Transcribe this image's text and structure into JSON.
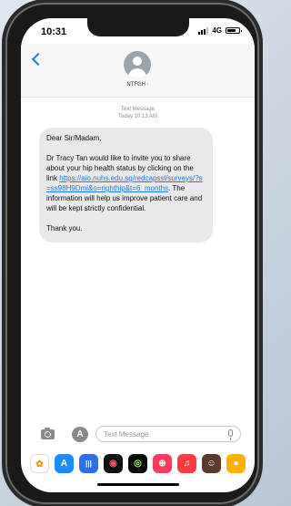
{
  "status_bar": {
    "time": "10:31",
    "network": "4G",
    "signal_level": 0.75,
    "battery_level": 0.75
  },
  "header": {
    "contact_name": "NTFGH"
  },
  "conversation": {
    "message_type": "Text Message",
    "timestamp": "Today 10:13 AM",
    "message": {
      "greeting": "Dear Sir/Madam,",
      "body_before_link": "Dr Tracy Tan would like to invite you to share about your hip health status by clicking on the link",
      "link": "https://aio.nuhs.edu.sg/redcapssl/surveys/?s=ss98H9Dmi&o=righthip&t=6_months",
      "body_after_link": ". The information will help us improve patient care and will be kept strictly confidential.",
      "closing": "Thank you."
    }
  },
  "input_bar": {
    "placeholder": "Text Message"
  },
  "dock_apps": [
    {
      "icon": "photos-icon",
      "color": "#ffffff"
    },
    {
      "icon": "app-store-icon",
      "color": "#1a8cff"
    },
    {
      "icon": "audio-message-icon",
      "color": "#2f6fe4"
    },
    {
      "icon": "digital-touch-icon",
      "color": "#111111"
    },
    {
      "icon": "activity-icon",
      "color": "#0b0b0b"
    },
    {
      "icon": "search-images-icon",
      "color": "#ff3b5c"
    },
    {
      "icon": "music-icon",
      "color": "#fc3c44"
    },
    {
      "icon": "memoji-icon",
      "color": "#5a3a2a"
    },
    {
      "icon": "more-apps-icon",
      "color": "#ffb000"
    }
  ]
}
